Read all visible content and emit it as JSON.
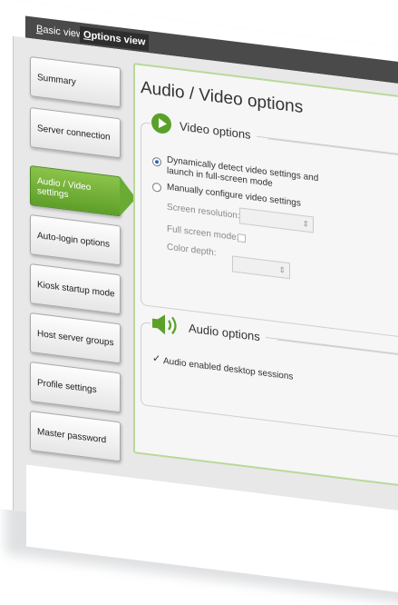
{
  "view_tabs": {
    "basic": {
      "underline": "B",
      "rest": "asic view"
    },
    "options": {
      "underline": "O",
      "rest": "ptions view"
    }
  },
  "sidebar": {
    "items": [
      {
        "label": "Summary"
      },
      {
        "label": "Server connection"
      },
      {
        "label": "Audio / Video settings"
      },
      {
        "label": "Auto-login options"
      },
      {
        "label": "Kiosk startup mode"
      },
      {
        "label": "Host server groups"
      },
      {
        "label": "Profile settings"
      },
      {
        "label": "Master password"
      }
    ],
    "active_index": 2
  },
  "main": {
    "title": "Audio / Video options",
    "video": {
      "title": "Video options",
      "icon": "play-circle-icon",
      "auto_option": "Dynamically detect video settings and launch in full-screen mode",
      "auto_line1": "Dynamically detect video settings and",
      "auto_line2": "launch in full-screen mode",
      "manual_option": "Manually configure video settings",
      "screen_resolution_label": "Screen resolution:",
      "full_screen_label": "Full screen mode:",
      "color_depth_label": "Color depth:",
      "selected": "auto"
    },
    "audio": {
      "title": "Audio options",
      "icon": "speaker-icon",
      "enabled_label": "Audio enabled desktop sessions",
      "enabled_checked": true
    }
  },
  "colors": {
    "accent_green": "#6aac33",
    "titlebar": "#4a4a4a"
  }
}
